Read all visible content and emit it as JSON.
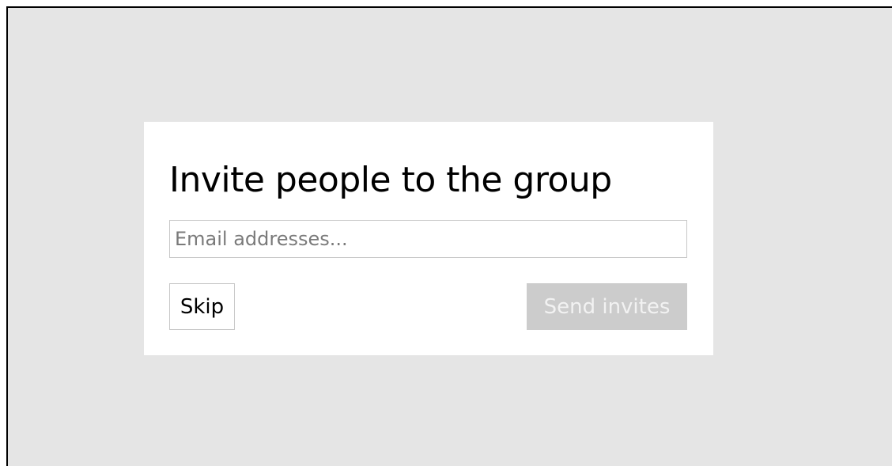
{
  "dialog": {
    "title": "Invite people to the group",
    "email_input": {
      "value": "",
      "placeholder": "Email addresses..."
    },
    "skip_label": "Skip",
    "send_label": "Send invites",
    "send_state": "disabled"
  },
  "colors": {
    "backdrop": "#e5e5e5",
    "dialog_background": "#ffffff",
    "send_button_disabled_bg": "#cccccc",
    "send_button_disabled_text": "#f2f2f2",
    "border": "#c8c8c8"
  }
}
